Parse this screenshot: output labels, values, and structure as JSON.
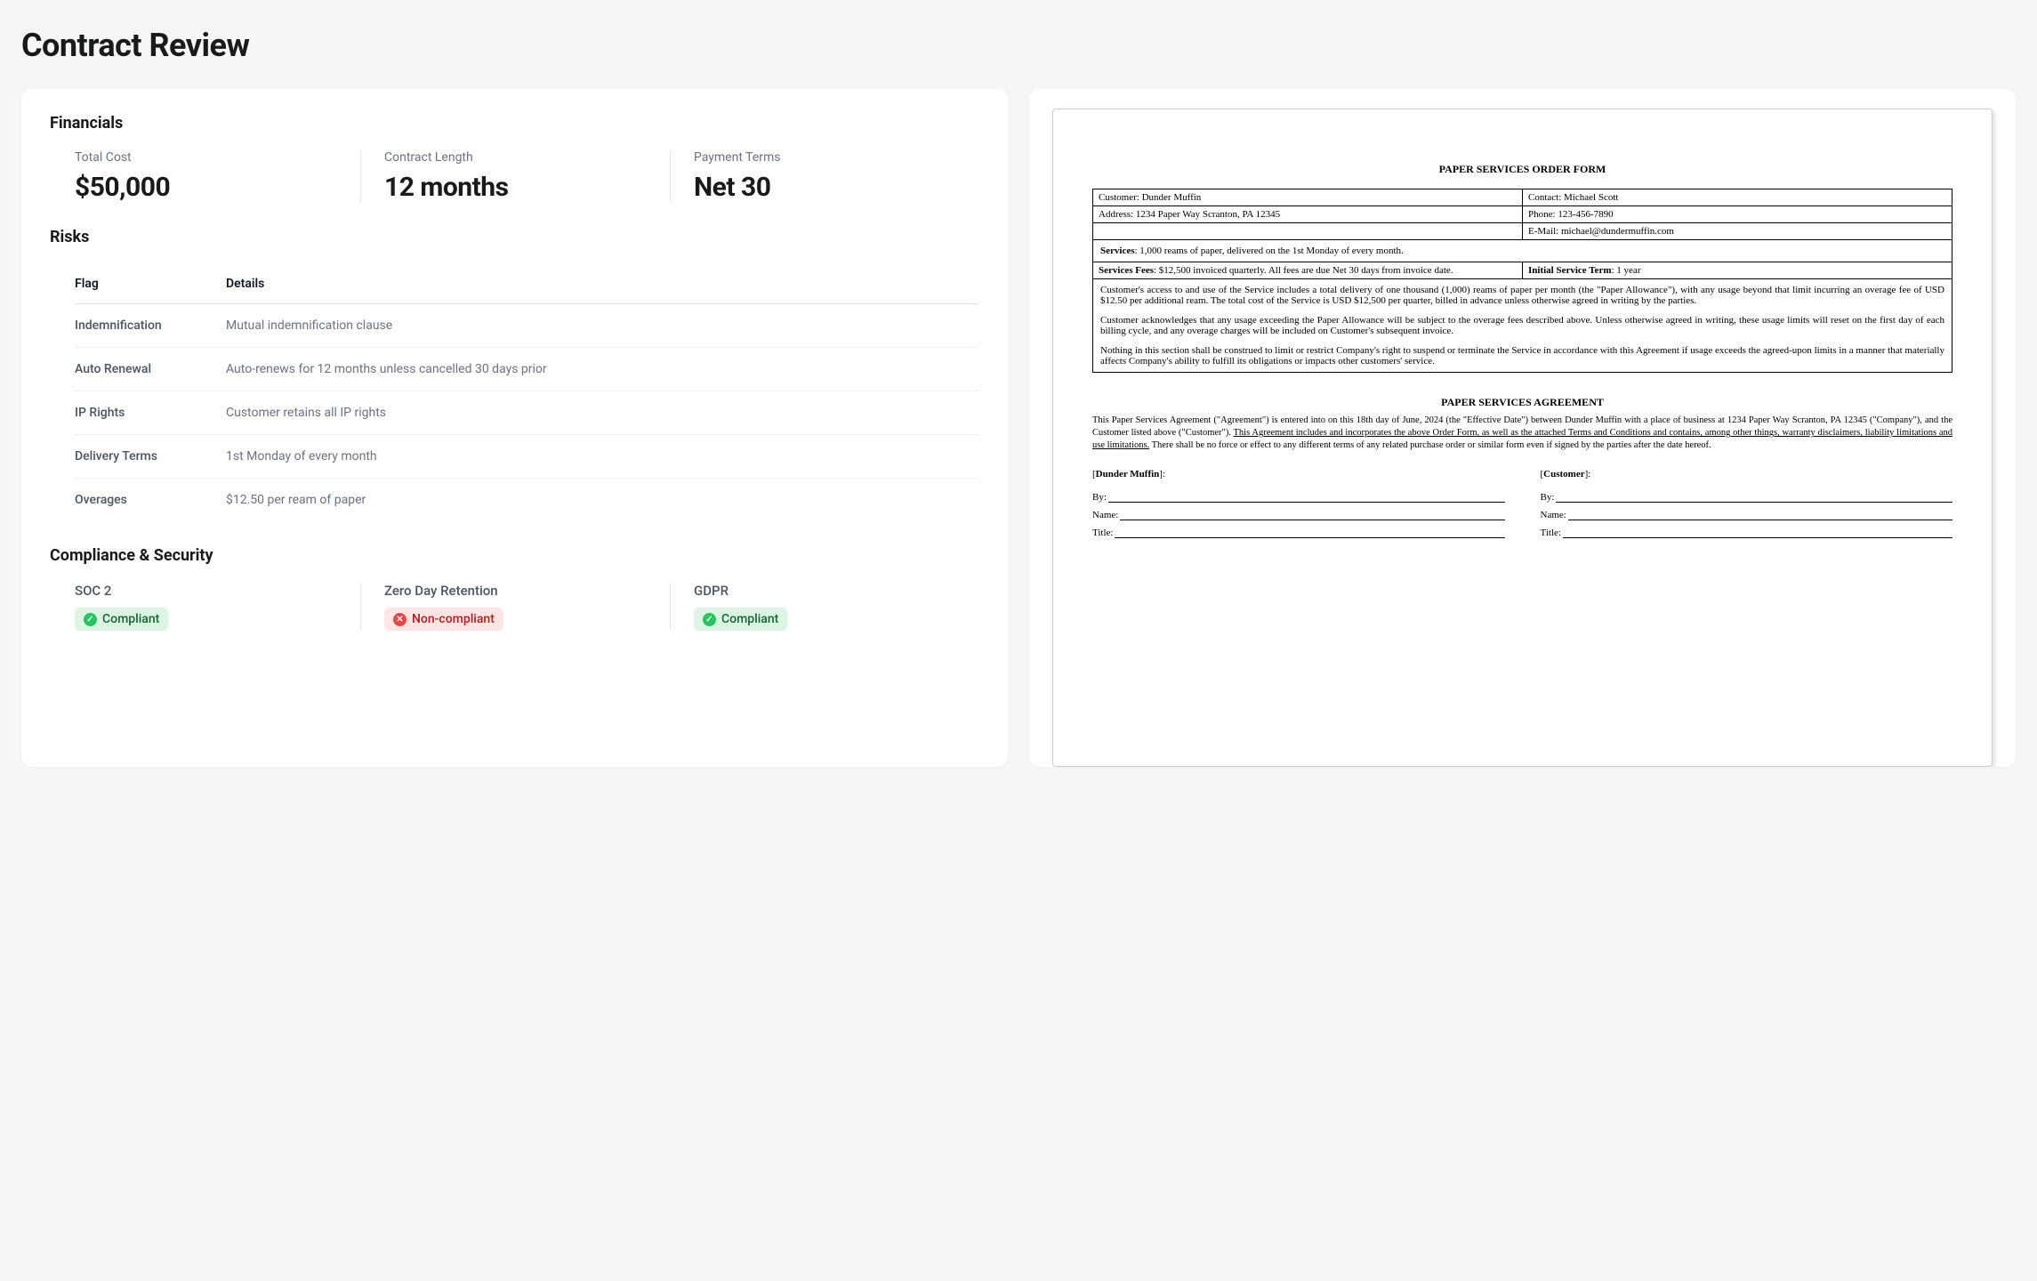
{
  "page_title": "Contract Review",
  "financials": {
    "heading": "Financials",
    "items": [
      {
        "label": "Total Cost",
        "value": "$50,000"
      },
      {
        "label": "Contract Length",
        "value": "12 months"
      },
      {
        "label": "Payment Terms",
        "value": "Net 30"
      }
    ]
  },
  "risks": {
    "heading": "Risks",
    "columns": {
      "flag": "Flag",
      "details": "Details"
    },
    "rows": [
      {
        "flag": "Indemnification",
        "details": "Mutual indemnification clause"
      },
      {
        "flag": "Auto Renewal",
        "details": "Auto-renews for 12 months unless cancelled 30 days prior"
      },
      {
        "flag": "IP Rights",
        "details": "Customer retains all IP rights"
      },
      {
        "flag": "Delivery Terms",
        "details": "1st Monday of every month"
      },
      {
        "flag": "Overages",
        "details": "$12.50 per ream of paper"
      }
    ]
  },
  "compliance": {
    "heading": "Compliance & Security",
    "items": [
      {
        "label": "SOC 2",
        "status": "Compliant",
        "compliant": true
      },
      {
        "label": "Zero Day Retention",
        "status": "Non-compliant",
        "compliant": false
      },
      {
        "label": "GDPR",
        "status": "Compliant",
        "compliant": true
      }
    ]
  },
  "document": {
    "order_form_title": "PAPER SERVICES ORDER FORM",
    "customer_label": "Customer:",
    "customer_value": "Dunder Muffin",
    "contact_label": "Contact:",
    "contact_value": "Michael Scott",
    "address_label": "Address:",
    "address_value": "1234 Paper Way Scranton, PA 12345",
    "phone_label": "Phone:",
    "phone_value": "123-456-7890",
    "email_label": "E-Mail:",
    "email_value": "michael@dundermuffin.com",
    "services_label": "Services",
    "services_text": ": 1,000 reams of paper, delivered on the 1st Monday of every month.",
    "fees_label": "Services Fees",
    "fees_text": ": $12,500 invoiced quarterly. All fees are due Net 30 days from invoice date.",
    "term_label": "Initial Service Term",
    "term_text": ": 1 year",
    "body_p1": "Customer's access to and use of the Service includes a total delivery of one thousand (1,000) reams of paper per month (the \"Paper Allowance\"), with any usage beyond that limit incurring an overage fee of USD $12.50 per additional ream. The total cost of the Service is USD $12,500 per quarter, billed in advance unless otherwise agreed in writing by the parties.",
    "body_p2": "Customer acknowledges that any usage exceeding the Paper Allowance will be subject to the overage fees described above. Unless otherwise agreed in writing, these usage limits will reset on the first day of each billing cycle, and any overage charges will be included on Customer's subsequent invoice.",
    "body_p3": "Nothing in this section shall be construed to limit or restrict Company's right to suspend or terminate the Service in accordance with this Agreement if usage exceeds the agreed-upon limits in a manner that materially affects Company's ability to fulfill its obligations or impacts other customers' service.",
    "agreement_title": "PAPER SERVICES AGREEMENT",
    "agreement_text_pre": "This Paper Services Agreement (\"Agreement\") is entered into on this 18th day of June, 2024 (the \"Effective Date\") between Dunder Muffin with a place of business at 1234 Paper Way Scranton, PA 12345 (\"Company\"), and the Customer listed above (\"Customer\"). ",
    "agreement_text_underlined": "This Agreement includes and incorporates the above Order Form, as well as the attached Terms and Conditions and contains, among other things, warranty disclaimers, liability limitations and use limitations.",
    "agreement_text_post": " There shall be no force or effect to any different terms of any related purchase order or similar form even if signed by the parties after the date hereof.",
    "sig_company": "[Dunder Muffin]:",
    "sig_customer": "[Customer]:",
    "sig_by": "By:",
    "sig_name": "Name:",
    "sig_title": "Title:"
  }
}
